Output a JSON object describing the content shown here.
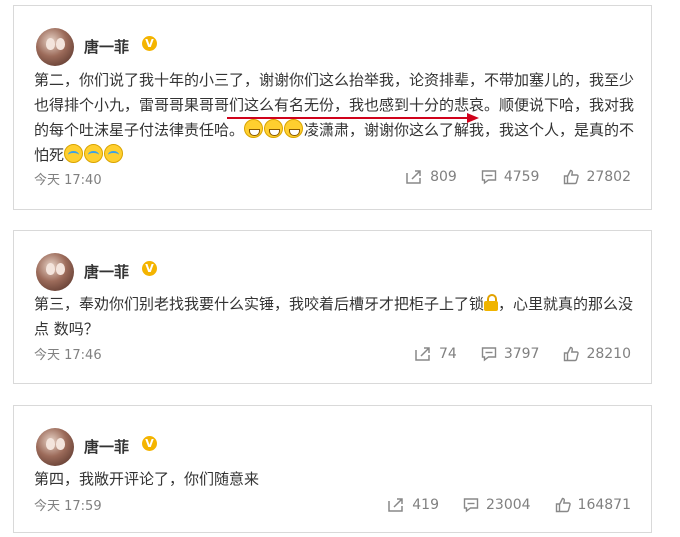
{
  "posts": [
    {
      "author": "唐一菲",
      "text_before_underline": "第二，你们说了我十年的小三了，谢谢你们这么抬举我，论资排辈，不带加塞儿的，我至少也得排个小九，",
      "underlined_text": "雷哥哥果哥哥们这么有名无份，",
      "text_after_underline": "我也感到十分的悲哀。顺便说下哈，我对我的每个吐沫星子付法律责任哈。",
      "text_after_emoji": "凌潇肃，谢谢你这么了解我，我这个人，是真的不怕死",
      "time": "今天 17:40",
      "shares": "809",
      "comments": "4759",
      "likes": "27802"
    },
    {
      "author": "唐一菲",
      "text_main": "第三，奉劝你们别老找我要什么实锤，我咬着后槽牙才把柜子上了锁",
      "text_tail": "，心里就真的那么没点 数吗？",
      "time": "今天 17:46",
      "shares": "74",
      "comments": "3797",
      "likes": "28210"
    },
    {
      "author": "唐一菲",
      "text_main": "第四，我敞开评论了，你们随意来",
      "time": "今天 17:59",
      "shares": "419",
      "comments": "23004",
      "likes": "164871"
    }
  ],
  "icons": {
    "verified": "verified-v-badge",
    "share": "share-icon",
    "comment": "comment-icon",
    "like": "thumbs-up-icon",
    "grin_emoji": "grinning-emoji",
    "cry_laugh_emoji": "crying-laughing-emoji",
    "lock_emoji": "lock-emoji"
  },
  "colors": {
    "annotation_red": "#d0021b",
    "verified_gold": "#f4b400",
    "meta_gray": "#808080"
  }
}
